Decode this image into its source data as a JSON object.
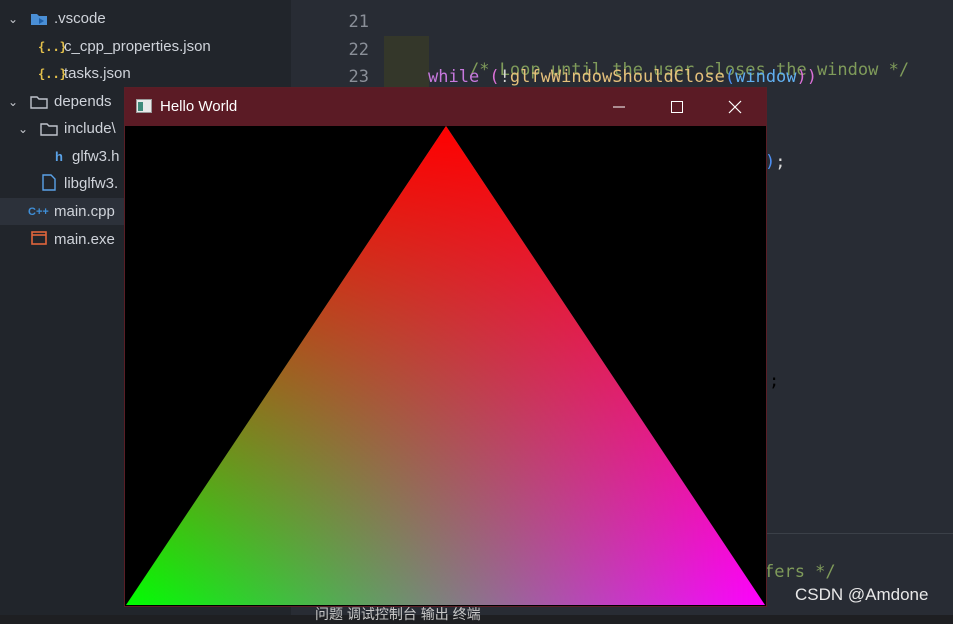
{
  "explorer": {
    "items": [
      {
        "label": ".vscode",
        "type": "folder",
        "expanded": true
      },
      {
        "label": "c_cpp_properties.json",
        "type": "json"
      },
      {
        "label": "tasks.json",
        "type": "json"
      },
      {
        "label": "depends",
        "type": "folder",
        "expanded": true
      },
      {
        "label": "include\\",
        "type": "folder",
        "expanded": true
      },
      {
        "label": "glfw3.h",
        "type": "header"
      },
      {
        "label": "libglfw3.",
        "type": "lib"
      },
      {
        "label": "main.cpp",
        "type": "cpp",
        "selected": true
      },
      {
        "label": "main.exe",
        "type": "exe"
      }
    ],
    "json_icon": "{..}"
  },
  "editor": {
    "line_numbers": [
      "21",
      "22",
      "23"
    ],
    "line22": {
      "comment": "/* Loop until the user closes the window */"
    },
    "line23": {
      "kw": "while",
      "open": " (",
      "bang": "!",
      "fn": "glfwWindowShouldClose",
      "paren_open": "(",
      "arg": "window",
      "paren_close": "))"
    },
    "fragment_a": ");",
    "fragment_b": ";",
    "fragment_c": "fers */"
  },
  "glfw_window": {
    "title": "Hello World",
    "minimize_icon": "minimize-icon",
    "maximize_icon": "maximize-icon",
    "close_icon": "close-icon",
    "titlebar_color": "#5b1b25",
    "background": "#000000",
    "triangle": {
      "top_vertex_color": "#ff0000",
      "bottom_left_vertex_color": "#00ff00",
      "bottom_right_vertex_color": "#ff00ff"
    }
  },
  "bottom_panel": {
    "tabs_text": "问题    调试控制台    输出    终端"
  },
  "watermark": "CSDN @Amdone"
}
